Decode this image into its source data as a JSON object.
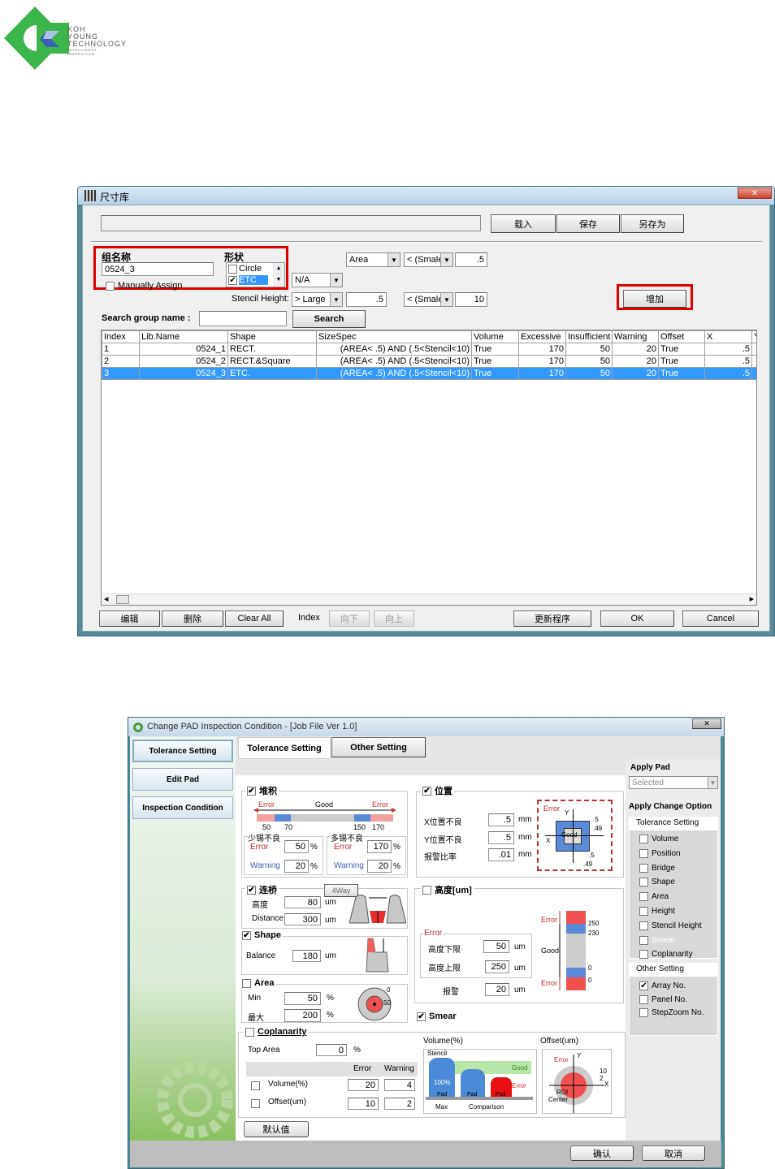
{
  "logo": {
    "line1": "KOH",
    "line2": "YOUNG",
    "line3": "TECHNOLOGY",
    "tagline1": "INTELLIGENT",
    "tagline2": "INSPECTION"
  },
  "win1": {
    "title": "尺寸库",
    "close": "✕",
    "path_value": "",
    "buttons": {
      "load": "载入",
      "save": "保存",
      "save_as": "另存为",
      "add": "增加",
      "search": "Search",
      "edit": "编辑",
      "delete": "删除",
      "clear_all": "Clear All",
      "index_label": "Index",
      "down": "向下",
      "up": "向上",
      "update": "更新程序",
      "ok": "OK",
      "cancel": "Cancel"
    },
    "group_name_label": "组名称",
    "group_name_value": "0524_3",
    "manual_assign": "Manually Assign",
    "shape_label": "形状",
    "shape_options": [
      {
        "label": "Circle",
        "checked": false
      },
      {
        "label": "ETC",
        "checked": true
      }
    ],
    "na_select": "N/A",
    "area_select": "Area",
    "area_cmp": "< (Smale",
    "area_value": ".5",
    "stencil_label": "Stencil Height:",
    "stencil_cmp1": "> Large",
    "stencil_val1": ".5",
    "stencil_cmp2": "< (Smale",
    "stencil_val2": "10",
    "search_label": "Search group name :",
    "search_value": "",
    "columns": [
      "Index",
      "Lib.Name",
      "Shape",
      "SizeSpec",
      "Volume",
      "Excessive",
      "Insufficient",
      "Warning",
      "Offset",
      "X",
      "Y"
    ],
    "rows": [
      [
        "1",
        "0524_1",
        "RECT.",
        "(AREA< .5) AND (.5<Stencil<10)",
        "True",
        "170",
        "50",
        "20",
        "True",
        ".5",
        ""
      ],
      [
        "2",
        "0524_2",
        "RECT.&Square",
        "(AREA< .5) AND (.5<Stencil<10)",
        "True",
        "170",
        "50",
        "20",
        "True",
        ".5",
        ""
      ],
      [
        "3",
        "0524_3",
        "ETC.",
        "(AREA< .5) AND (.5<Stencil<10)",
        "True",
        "170",
        "50",
        "20",
        "True",
        ".5",
        ""
      ]
    ],
    "selected_row": 2
  },
  "win2": {
    "title": "Change PAD Inspection Condition - [Job File Ver 1.0]",
    "close": "✕",
    "side": [
      "Tolerance Setting",
      "Edit Pad",
      "Inspection Condition"
    ],
    "tabs": [
      "Tolerance Setting",
      "Other Setting"
    ],
    "volume": {
      "title": "堆积",
      "checked": true,
      "error": "Error",
      "good": "Good",
      "ticks": [
        "50",
        "70",
        "150",
        "170"
      ],
      "insufficient": {
        "title": "少锡不良",
        "error_label": "Error",
        "error": "50",
        "warning_label": "Warning",
        "warning": "20",
        "unit": "%"
      },
      "excessive": {
        "title": "多锡不良",
        "error_label": "Error",
        "error": "170",
        "warning_label": "Warning",
        "warning": "20",
        "unit": "%"
      }
    },
    "position": {
      "title": "位置",
      "checked": true,
      "x_label": "X位置不良",
      "x": ".5",
      "y_label": "Y位置不良",
      "y": ".5",
      "rate_label": "报警比率",
      "rate": ".01",
      "unit": "mm",
      "diagram": {
        "error": "Error",
        "good": "Good",
        "x": "X",
        "y": "Y",
        "v1": ".5",
        "v2": ".49",
        "v3": ".5",
        "v4": ".49"
      }
    },
    "bridge": {
      "title": "连桥",
      "checked": true,
      "fourway": "4Way",
      "height_label": "高度",
      "height": "80",
      "distance_label": "Distance",
      "distance": "300",
      "unit": "um"
    },
    "shape": {
      "title": "Shape",
      "checked": true,
      "balance_label": "Balance",
      "balance": "180",
      "unit": "um"
    },
    "area": {
      "title": "Area",
      "checked": false,
      "min_label": "Min",
      "min": "50",
      "max_label": "最大",
      "max": "200",
      "unit": "%",
      "d0": "0",
      "d50": "50"
    },
    "height": {
      "title": "高度[um]",
      "checked": false,
      "error_box": "Error",
      "low_label": "高度下限",
      "low": "50",
      "high_label": "高度上限",
      "high": "250",
      "warn_label": "报警",
      "warn": "20",
      "unit": "um",
      "gauge": {
        "error_top": "Error",
        "good": "Good",
        "error_bottom": "Error",
        "t250": "250",
        "t230": "230",
        "t0a": "0",
        "t0b": "0"
      }
    },
    "smear": {
      "title": "Smear",
      "checked": true
    },
    "coplanarity": {
      "title": "Coplanarity",
      "checked": false,
      "top_area_label": "Top Area",
      "top_area": "0",
      "unit": "%",
      "headers": [
        "Error",
        "Warning"
      ],
      "rows": [
        {
          "label": "Volume(%)",
          "error": "20",
          "warning": "4"
        },
        {
          "label": "Offset(um)",
          "error": "10",
          "warning": "2"
        }
      ],
      "vol_title": "Volume(%)",
      "vol_diag": {
        "stencil": "Stencil",
        "good": "Good",
        "error": "Error",
        "pct": "100%",
        "pad": "Pad",
        "max": "Max",
        "comparison": "Comparison"
      },
      "off_title": "Offset(um)",
      "off_diag": {
        "error": "Error",
        "y": "Y",
        "x": "X",
        "v10": "10",
        "v2": "2",
        "roi": "ROI",
        "center": "Center"
      }
    },
    "default_button": "默认值",
    "apply_pad_label": "Apply Pad",
    "apply_pad_value": "Selected",
    "apply_change_label": "Apply Change Option",
    "tol_box_title": "Tolerance Setting",
    "tol_items": [
      {
        "label": "Volume",
        "checked": false
      },
      {
        "label": "Position",
        "checked": false
      },
      {
        "label": "Bridge",
        "checked": false
      },
      {
        "label": "Shape",
        "checked": false
      },
      {
        "label": "Area",
        "checked": false
      },
      {
        "label": "Height",
        "checked": false
      },
      {
        "label": "Stencil Height",
        "checked": false
      },
      {
        "label": "Smear",
        "checked": false,
        "disabled": true
      },
      {
        "label": "Coplanarity",
        "checked": false
      }
    ],
    "other_box_title": "Other Setting",
    "other_items": [
      {
        "label": "Array No.",
        "checked": true
      },
      {
        "label": "Panel No.",
        "checked": false
      },
      {
        "label": "StepZoom No.",
        "checked": false
      }
    ],
    "confirm": "确认",
    "cancel": "取消"
  }
}
